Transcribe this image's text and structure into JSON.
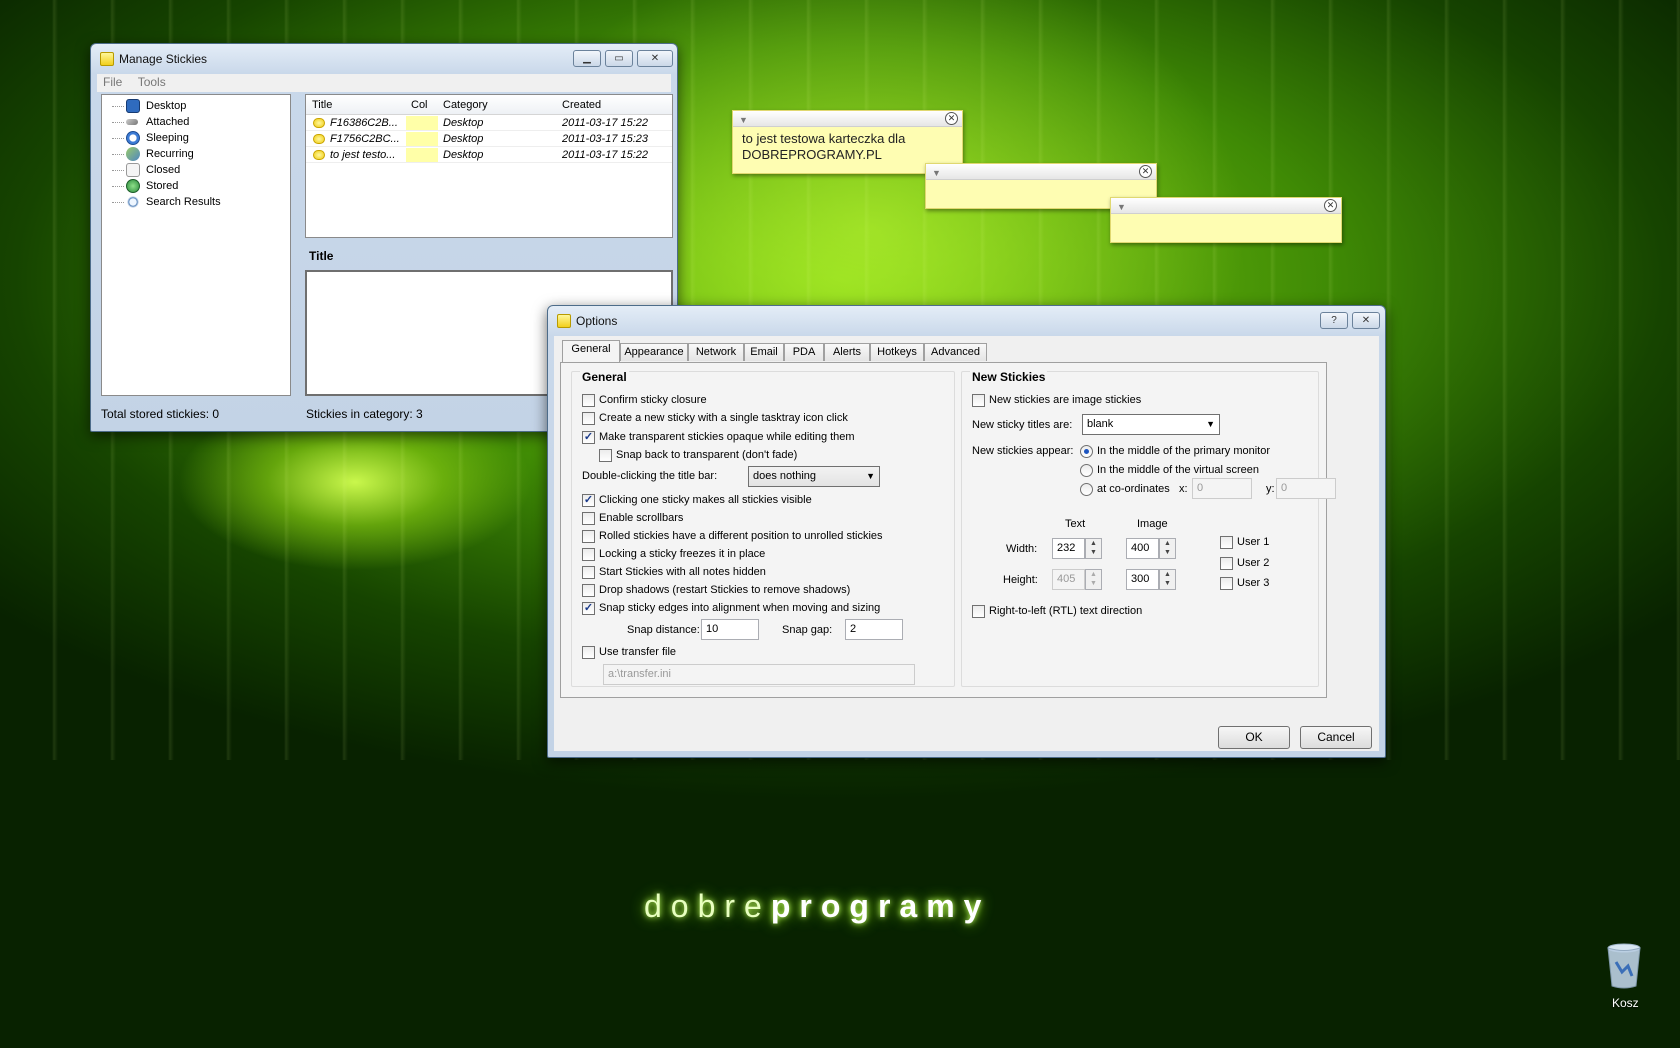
{
  "desktop": {
    "brand_light": "dobre",
    "brand_bold": "programy",
    "recycle_bin_label": "Kosz"
  },
  "manage": {
    "title": "Manage Stickies",
    "menu": [
      "File",
      "Tools"
    ],
    "tree": [
      "Desktop",
      "Attached",
      "Sleeping",
      "Recurring",
      "Closed",
      "Stored",
      "Search Results"
    ],
    "columns": [
      "Title",
      "Col",
      "Category",
      "Created"
    ],
    "rows": [
      {
        "title": "F16386C2B...",
        "category": "Desktop",
        "created": "2011-03-17 15:22"
      },
      {
        "title": "F1756C2BC...",
        "category": "Desktop",
        "created": "2011-03-17 15:23"
      },
      {
        "title": "to jest testo...",
        "category": "Desktop",
        "created": "2011-03-17 15:22"
      }
    ],
    "detail_title": "Title",
    "status_left": "Total stored stickies: 0",
    "status_right": "Stickies in category: 3"
  },
  "stickies": [
    {
      "text_line1": "to jest testowa karteczka dla",
      "text_line2": "DOBREPROGRAMY.PL"
    },
    {
      "text_line1": "",
      "text_line2": ""
    },
    {
      "text_line1": "",
      "text_line2": ""
    }
  ],
  "options": {
    "title": "Options",
    "help_btn": "?",
    "tabs": [
      "General",
      "Appearance",
      "Network",
      "Email",
      "PDA",
      "Alerts",
      "Hotkeys",
      "Advanced"
    ],
    "general": {
      "heading": "General",
      "confirm_closure": "Confirm sticky closure",
      "single_click_new": "Create a new sticky with a single tasktray icon click",
      "transparent_opaque": "Make transparent stickies opaque while editing them",
      "snap_back": "Snap back to transparent (don't fade)",
      "double_click_label": "Double-clicking the title bar:",
      "double_click_value": "does nothing",
      "clicking_one": "Clicking one sticky makes all stickies visible",
      "enable_scrollbars": "Enable scrollbars",
      "rolled_position": "Rolled stickies have a different position to unrolled stickies",
      "locking_freezes": "Locking a sticky freezes it in place",
      "start_hidden": "Start Stickies with all notes hidden",
      "drop_shadows": "Drop shadows (restart Stickies to remove shadows)",
      "snap_edges": "Snap sticky edges into alignment when moving and sizing",
      "snap_distance_label": "Snap distance:",
      "snap_distance_value": "10",
      "snap_gap_label": "Snap gap:",
      "snap_gap_value": "2",
      "use_transfer": "Use transfer file",
      "transfer_path": "a:\\transfer.ini"
    },
    "new_stickies": {
      "heading": "New Stickies",
      "image_stickies": "New stickies are image stickies",
      "titles_label": "New sticky titles are:",
      "titles_value": "blank",
      "appear_label": "New stickies appear:",
      "appear_primary": "In the middle of the primary monitor",
      "appear_virtual": "In the middle of the virtual screen",
      "appear_coords": "at co-ordinates",
      "x_label": "x:",
      "x_value": "0",
      "y_label": "y:",
      "y_value": "0",
      "text_header": "Text",
      "image_header": "Image",
      "width_label": "Width:",
      "height_label": "Height:",
      "text_width": "232",
      "text_height": "405",
      "image_width": "400",
      "image_height": "300",
      "user1": "User 1",
      "user2": "User 2",
      "user3": "User 3",
      "rtl": "Right-to-left (RTL) text direction"
    },
    "ok": "OK",
    "cancel": "Cancel"
  }
}
